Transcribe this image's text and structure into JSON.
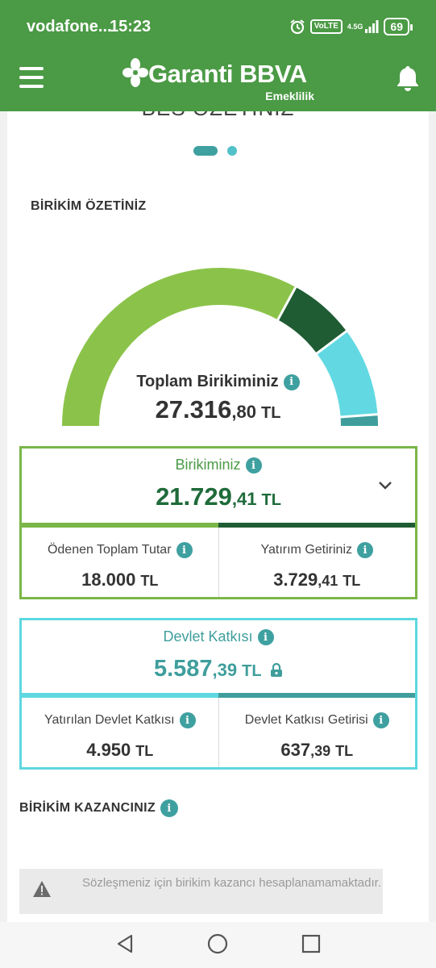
{
  "status_bar": {
    "carrier": "vodafone...",
    "time": "15:23",
    "network": "4.5G",
    "volte": "VoLTE",
    "battery": "69"
  },
  "app_bar": {
    "brand": "Garanti BBVA",
    "subtitle": "Emeklilik",
    "icons": [
      "menu-icon",
      "bell-icon"
    ]
  },
  "carousel": {
    "partial_title": "BES ÖZETİNİZ",
    "pages": 2,
    "active_page": 1
  },
  "savings_summary": {
    "title": "BİRİKİM ÖZETİNİZ",
    "total_label": "Toplam Birikiminiz",
    "total_int": "27.316",
    "total_dec": ",80",
    "currency": "TL",
    "gauge": {
      "segments": [
        {
          "name": "Ödenen Toplam Tutar",
          "value": 18000,
          "color": "#8bc34a"
        },
        {
          "name": "Yatırım Getiriniz",
          "value": 3729.41,
          "color": "#1f5c33"
        },
        {
          "name": "Yatırılan Devlet Katkısı",
          "value": 4950,
          "color": "#62d9e2"
        },
        {
          "name": "Devlet Katkısı Getirisi",
          "value": 637.39,
          "color": "#3f9e9c"
        }
      ]
    }
  },
  "own_savings": {
    "label": "Birikiminiz",
    "value_int": "21.729",
    "value_dec": ",41",
    "currency": "TL",
    "paid_label": "Ödenen Toplam Tutar",
    "paid_int": "18.000",
    "paid_dec": "",
    "return_label": "Yatırım Getiriniz",
    "return_int": "3.729",
    "return_dec": ",41",
    "colors": {
      "primary": "#1f6b3a",
      "accent": "#7ab648"
    }
  },
  "state_contribution": {
    "label": "Devlet Katkısı",
    "value_int": "5.587",
    "value_dec": ",39",
    "currency": "TL",
    "deposited_label": "Yatırılan Devlet Katkısı",
    "deposited_int": "4.950",
    "deposited_dec": "",
    "return_label": "Devlet Katkısı Getirisi",
    "return_int": "637",
    "return_dec": ",39",
    "colors": {
      "primary": "#3f9e9c",
      "accent": "#5ed7e0"
    }
  },
  "savings_gain": {
    "title": "BİRİKİM KAZANCINIZ",
    "warning": "Sözleşmeniz için birikim kazancı hesaplanamamaktadır."
  },
  "nav_bar": {
    "icons": [
      "back-icon",
      "home-icon",
      "recents-icon"
    ]
  }
}
